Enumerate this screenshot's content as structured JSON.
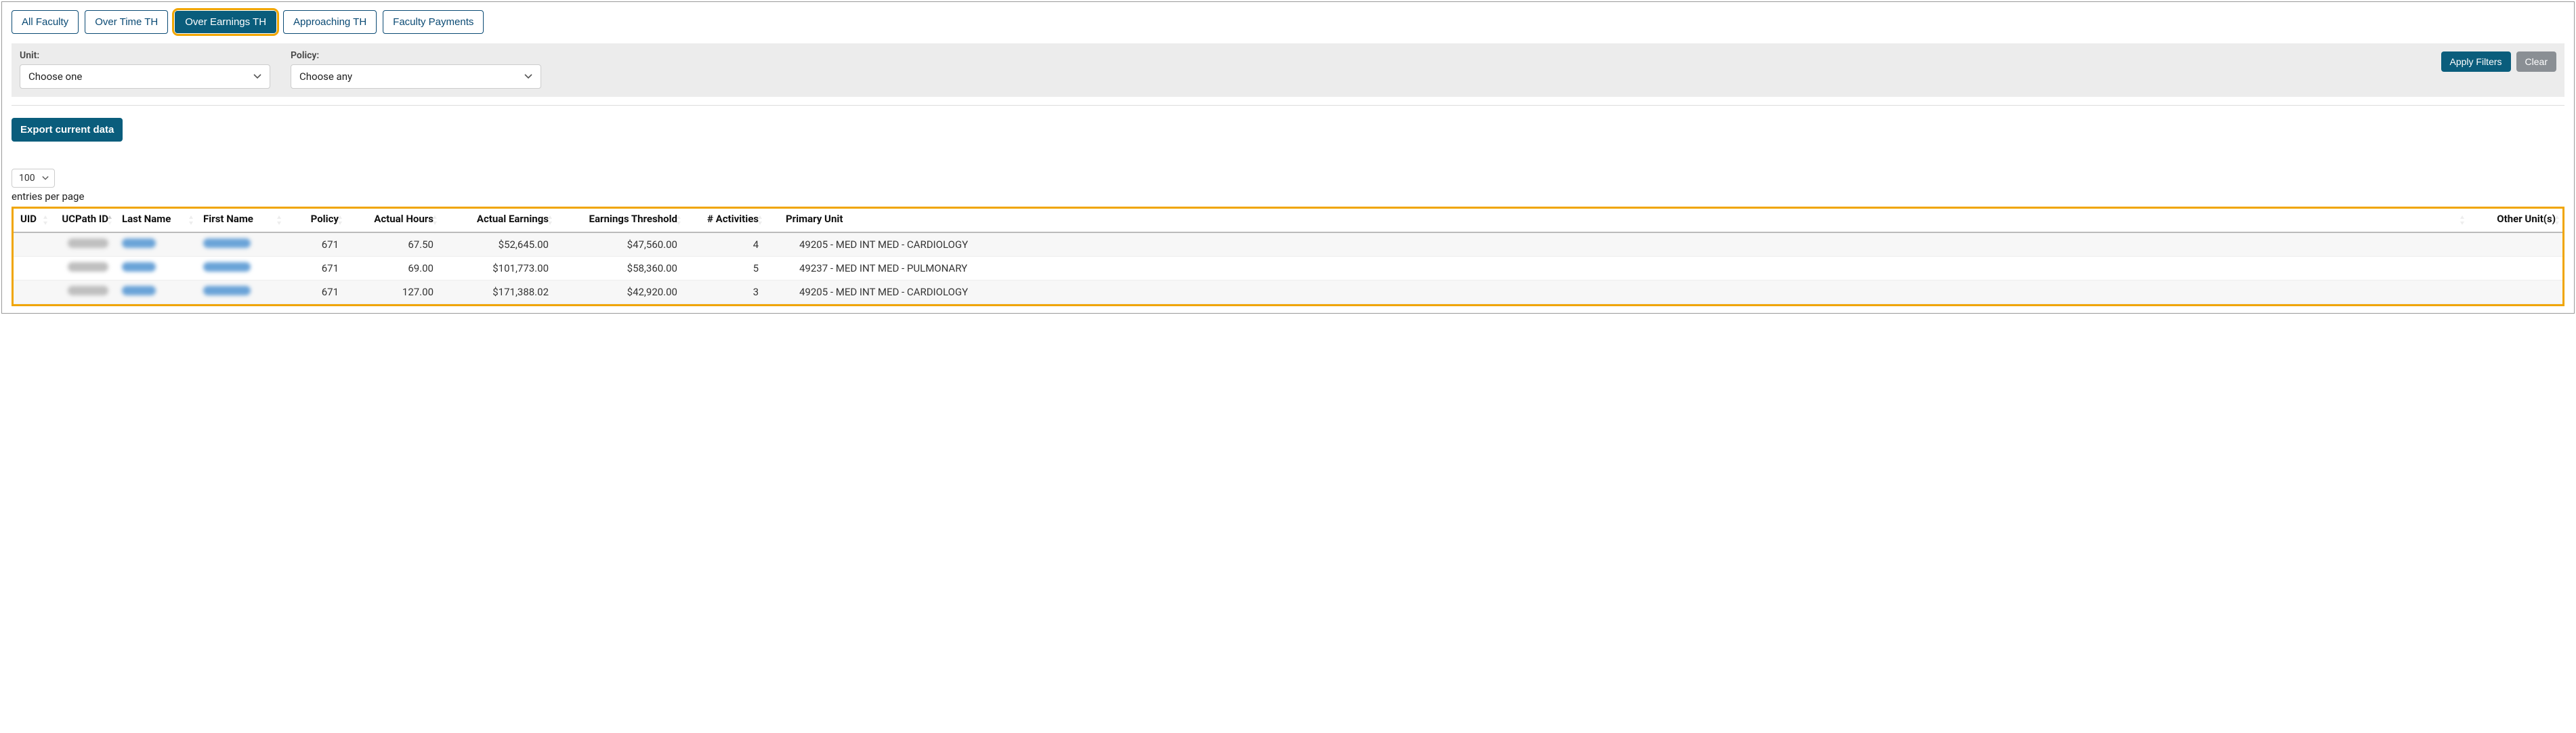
{
  "tabs": [
    {
      "label": "All Faculty",
      "active": false
    },
    {
      "label": "Over Time TH",
      "active": false
    },
    {
      "label": "Over Earnings TH",
      "active": true
    },
    {
      "label": "Approaching TH",
      "active": false
    },
    {
      "label": "Faculty Payments",
      "active": false
    }
  ],
  "filters": {
    "unit_label": "Unit:",
    "unit_placeholder": "Choose one",
    "policy_label": "Policy:",
    "policy_placeholder": "Choose any",
    "apply_label": "Apply Filters",
    "clear_label": "Clear"
  },
  "export_label": "Export current data",
  "page_size": {
    "value": "100",
    "suffix": "entries per page"
  },
  "columns": [
    {
      "label": "UID",
      "align": "left",
      "sorter": true
    },
    {
      "label": "UCPath ID",
      "align": "right",
      "sorter": true,
      "sorted_asc": true
    },
    {
      "label": "Last Name",
      "align": "left",
      "sorter": true
    },
    {
      "label": "First Name",
      "align": "left",
      "sorter": true
    },
    {
      "label": "Policy",
      "align": "right",
      "sorter": true
    },
    {
      "label": "Actual Hours",
      "align": "right",
      "sorter": true
    },
    {
      "label": "Actual Earnings",
      "align": "right",
      "sorter": true
    },
    {
      "label": "Earnings Threshold",
      "align": "right",
      "sorter": true
    },
    {
      "label": "# Activities",
      "align": "right",
      "sorter": true
    },
    {
      "label": "Primary Unit",
      "align": "left",
      "sorter": true
    },
    {
      "label": "Other Unit(s)",
      "align": "right",
      "sorter": true
    }
  ],
  "rows": [
    {
      "uid": "",
      "ucpath_id": "",
      "last_name": "",
      "first_name": "",
      "policy": "671",
      "actual_hours": "67.50",
      "actual_earnings": "$52,645.00",
      "earnings_threshold": "$47,560.00",
      "activities": "4",
      "primary_unit": "49205 - MED INT MED - CARDIOLOGY",
      "other_units": ""
    },
    {
      "uid": "",
      "ucpath_id": "",
      "last_name": "",
      "first_name": "",
      "policy": "671",
      "actual_hours": "69.00",
      "actual_earnings": "$101,773.00",
      "earnings_threshold": "$58,360.00",
      "activities": "5",
      "primary_unit": "49237 - MED INT MED - PULMONARY",
      "other_units": ""
    },
    {
      "uid": "",
      "ucpath_id": "",
      "last_name": "",
      "first_name": "",
      "policy": "671",
      "actual_hours": "127.00",
      "actual_earnings": "$171,388.02",
      "earnings_threshold": "$42,920.00",
      "activities": "3",
      "primary_unit": "49205 - MED INT MED - CARDIOLOGY",
      "other_units": ""
    }
  ]
}
